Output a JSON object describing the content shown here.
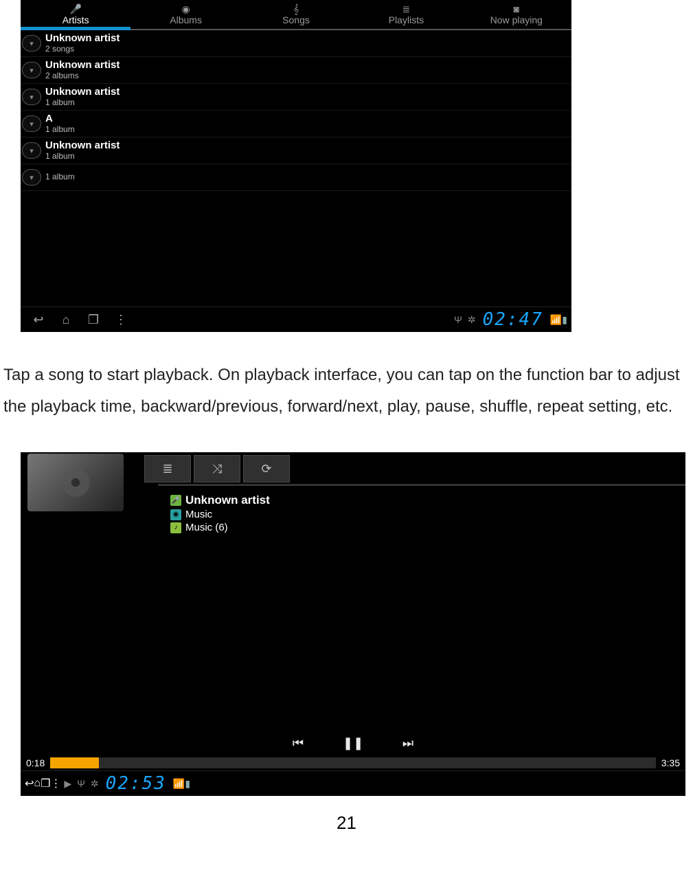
{
  "shot1": {
    "tabs": [
      "Artists",
      "Albums",
      "Songs",
      "Playlists",
      "Now playing"
    ],
    "active_tab": 0,
    "artists": [
      {
        "name": "Unknown artist",
        "sub": "2 songs"
      },
      {
        "name": "Unknown artist",
        "sub": "2 albums"
      },
      {
        "name": "Unknown artist",
        "sub": "1 album"
      },
      {
        "name": "A",
        "sub": "1 album"
      },
      {
        "name": "Unknown artist",
        "sub": "1 album"
      },
      {
        "name": "",
        "sub": "1 album"
      }
    ],
    "clock": "02:47"
  },
  "paragraph": "Tap a song to start playback.   On playback interface, you can tap on the function bar to adjust the playback time, backward/previous, forward/next, play, pause, shuffle, repeat setting, etc.",
  "shot2": {
    "artist_line": "Unknown artist",
    "album_line": "Music",
    "track_line": "Music (6)",
    "elapsed": "0:18",
    "total": "3:35",
    "progress_pct": 8,
    "clock": "02:53"
  },
  "page_number": "21"
}
